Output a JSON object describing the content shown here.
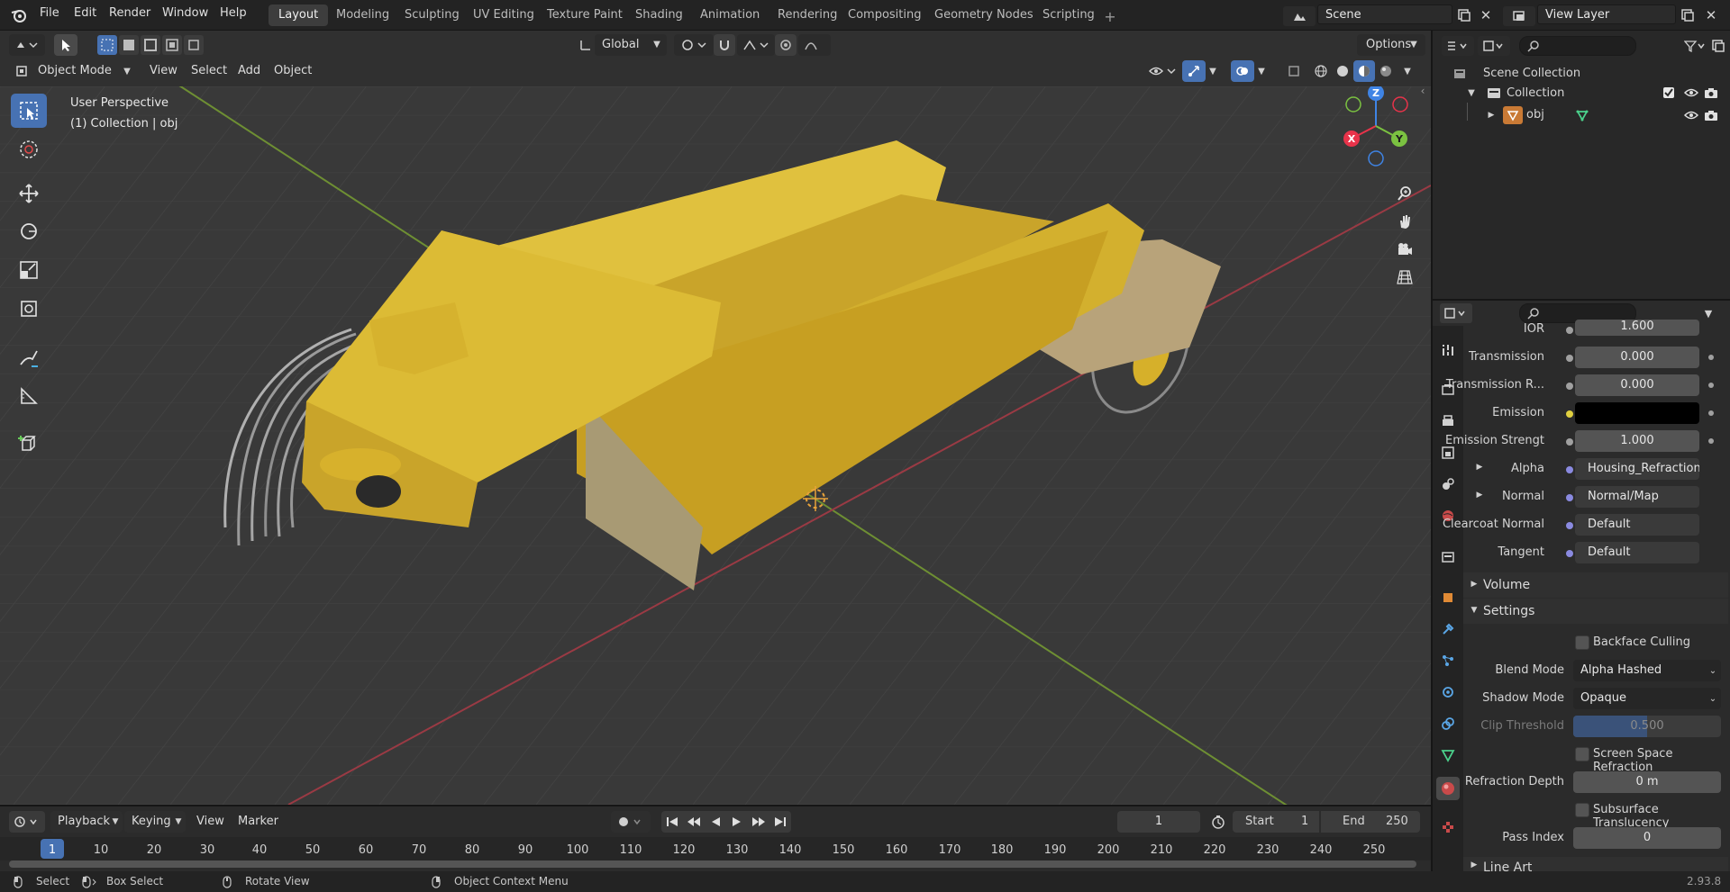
{
  "app": {
    "version": "2.93.8"
  },
  "menus": [
    "File",
    "Edit",
    "Render",
    "Window",
    "Help"
  ],
  "workspaces": [
    "Layout",
    "Modeling",
    "Sculpting",
    "UV Editing",
    "Texture Paint",
    "Shading",
    "Animation",
    "Rendering",
    "Compositing",
    "Geometry Nodes",
    "Scripting"
  ],
  "scene": {
    "name": "Scene",
    "view_layer": "View Layer"
  },
  "viewport_header": {
    "transform_orientation": "Global",
    "options_label": "Options",
    "mode": "Object Mode",
    "menus": [
      "View",
      "Select",
      "Add",
      "Object"
    ]
  },
  "viewport": {
    "perspective_label": "User Perspective",
    "context_label": "(1) Collection | obj",
    "gizmo": {
      "x": "X",
      "y": "Y",
      "z": "Z"
    }
  },
  "outliner": {
    "root": "Scene Collection",
    "collection": "Collection",
    "object": "obj"
  },
  "properties": {
    "rows": [
      {
        "label": "IOR",
        "value": "1.600"
      },
      {
        "label": "Transmission",
        "value": "0.000"
      },
      {
        "label": "Transmission R...",
        "value": "0.000"
      },
      {
        "label": "Emission",
        "value": ""
      },
      {
        "label": "Emission Strengt",
        "value": "1.000"
      },
      {
        "label": "Alpha",
        "value": "Housing_Refraction..."
      },
      {
        "label": "Normal",
        "value": "Normal/Map"
      },
      {
        "label": "Clearcoat Normal",
        "value": "Default"
      },
      {
        "label": "Tangent",
        "value": "Default"
      }
    ],
    "sections": {
      "volume": "Volume",
      "settings": "Settings",
      "line_art": "Line Art"
    },
    "settings": {
      "backface_culling": "Backface Culling",
      "blend_mode_label": "Blend Mode",
      "blend_mode": "Alpha Hashed",
      "shadow_mode_label": "Shadow Mode",
      "shadow_mode": "Opaque",
      "clip_threshold_label": "Clip Threshold",
      "clip_threshold": "0.500",
      "ssr_label": "Screen Space Refraction",
      "refraction_depth_label": "Refraction Depth",
      "refraction_depth": "0 m",
      "sss_label": "Subsurface Translucency",
      "pass_index_label": "Pass Index",
      "pass_index": "0"
    }
  },
  "timeline": {
    "menus": [
      "Playback",
      "Keying",
      "View",
      "Marker"
    ],
    "current_frame": "1",
    "start_label": "Start",
    "start": "1",
    "end_label": "End",
    "end": "250",
    "ruler": [
      "1",
      "10",
      "20",
      "30",
      "40",
      "50",
      "60",
      "70",
      "80",
      "90",
      "100",
      "110",
      "120",
      "130",
      "140",
      "150",
      "160",
      "170",
      "180",
      "190",
      "200",
      "210",
      "220",
      "230",
      "240",
      "250"
    ]
  },
  "status": {
    "select": "Select",
    "box_select": "Box Select",
    "rotate_view": "Rotate View",
    "context_menu": "Object Context Menu"
  },
  "colors": {
    "accent": "#4772b3",
    "object_yellow": "#d8b42a",
    "x_axis": "#e8334a",
    "y_axis": "#7bc241",
    "z_axis": "#3f84e5"
  }
}
